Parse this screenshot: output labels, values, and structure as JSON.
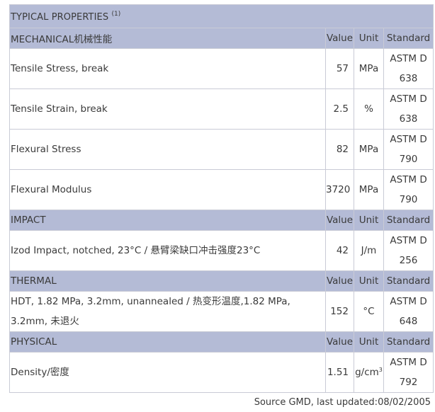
{
  "title": "TYPICAL PROPERTIES",
  "title_note": "(1)",
  "columns": {
    "value": "Value",
    "unit": "Unit",
    "standard": "Standard"
  },
  "mechanical": {
    "name": "MECHANICAL机械性能",
    "rows": [
      {
        "property": "Tensile Stress, break",
        "value": "57",
        "unit": "MPa",
        "std_1": "ASTM D",
        "std_2": "638"
      },
      {
        "property": "Tensile Strain, break",
        "value": "2.5",
        "unit": "%",
        "std_1": "ASTM D",
        "std_2": "638"
      },
      {
        "property": "Flexural Stress",
        "value": "82",
        "unit": "MPa",
        "std_1": "ASTM D",
        "std_2": "790"
      },
      {
        "property": "Flexural Modulus",
        "value": "3720",
        "unit": "MPa",
        "std_1": "ASTM D",
        "std_2": "790"
      }
    ]
  },
  "impact": {
    "name": "IMPACT",
    "rows": [
      {
        "property": "Izod Impact, notched, 23°C / 悬臂梁缺口冲击强度23°C",
        "value": "42",
        "unit": "J/m",
        "std_1": "ASTM D",
        "std_2": "256"
      }
    ]
  },
  "thermal": {
    "name": "THERMAL",
    "rows": [
      {
        "property": "HDT, 1.82 MPa, 3.2mm, unannealed / 热变形温度,1.82 MPa, 3.2mm, 未退火",
        "value": "152",
        "unit": "°C",
        "std_1": "ASTM D",
        "std_2": "648"
      }
    ]
  },
  "physical": {
    "name": "PHYSICAL",
    "rows": [
      {
        "property": "Density/密度",
        "value": "1.51",
        "unit": "g/cm",
        "unit_sup": "3",
        "std_1": "ASTM D",
        "std_2": "792"
      }
    ]
  },
  "source": "Source GMD, last updated:08/02/2005"
}
